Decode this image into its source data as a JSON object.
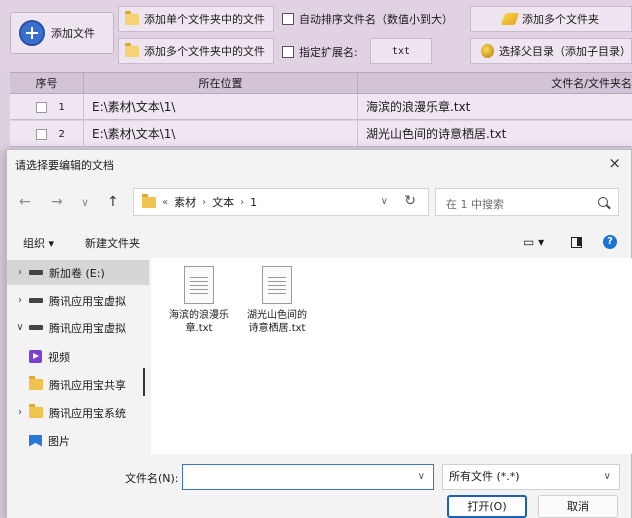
{
  "toolbar": {
    "add_file": "添加文件",
    "add_single_folder": "添加单个文件夹中的文件",
    "add_multi_folder": "添加多个文件夹中的文件",
    "auto_sort": "自动排序文件名（数值小到大）",
    "specify_ext": "指定扩展名:",
    "ext_value": "txt",
    "add_multi_folders": "添加多个文件夹",
    "select_parent": "选择父目录（添加子目录）"
  },
  "table": {
    "headers": {
      "index": "序号",
      "location": "所在位置",
      "filename": "文件名/文件夹名"
    },
    "rows": [
      {
        "index": "1",
        "location": "E:\\素材\\文本\\1\\",
        "filename": "海滨的浪漫乐章.txt"
      },
      {
        "index": "2",
        "location": "E:\\素材\\文本\\1\\",
        "filename": "湖光山色间的诗意栖居.txt"
      }
    ]
  },
  "dialog": {
    "title": "请选择要编辑的文档",
    "close": "×",
    "nav": {
      "back": "←",
      "forward": "→",
      "recent": "∨",
      "up": "↑"
    },
    "address": {
      "prefix": "«",
      "crumbs": [
        "素材",
        "文本",
        "1"
      ],
      "separator": "›"
    },
    "search_placeholder": "在 1 中搜索",
    "commands": {
      "organize": "组织 ▾",
      "new_folder": "新建文件夹"
    },
    "nav_pane": [
      {
        "label": "新加卷 (E:)",
        "icon": "drive-icon",
        "chevron": "›",
        "selected": true
      },
      {
        "label": "腾讯应用宝虚拟",
        "icon": "drive-icon",
        "chevron": "›"
      },
      {
        "label": "腾讯应用宝虚拟",
        "icon": "drive-icon",
        "chevron": "∨"
      },
      {
        "label": "视频",
        "icon": "video-icon",
        "chevron": ""
      },
      {
        "label": "腾讯应用宝共享",
        "icon": "folder-icon",
        "chevron": ""
      },
      {
        "label": "腾讯应用宝系统",
        "icon": "folder-icon",
        "chevron": "›"
      },
      {
        "label": "图片",
        "icon": "picture-icon",
        "chevron": ""
      }
    ],
    "files": [
      {
        "name": "海滨的浪漫乐章.txt"
      },
      {
        "name": "湖光山色间的诗意栖居.txt"
      }
    ],
    "filename_label": "文件名(N):",
    "filename_value": "",
    "filter_selected": "所有文件 (*.*)",
    "open_button": "打开(O)",
    "cancel_button": "取消"
  },
  "colors": {
    "accent": "#1e5fb8",
    "app_bg": "#e0d2e3",
    "link": "#1a3f8a"
  }
}
